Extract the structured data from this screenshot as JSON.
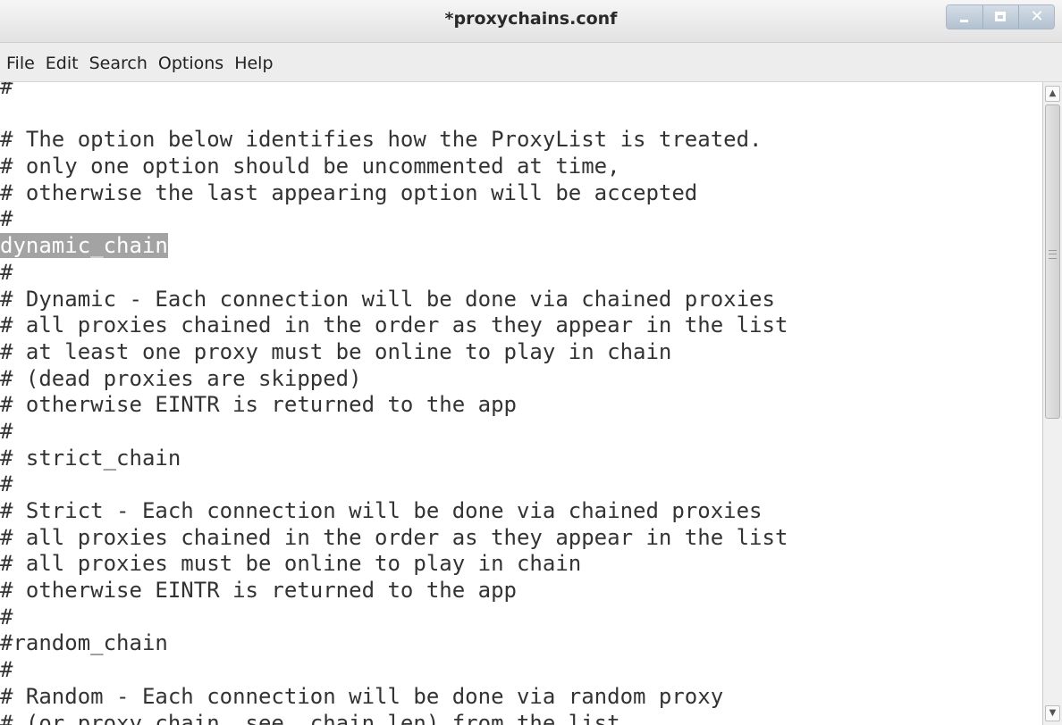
{
  "window": {
    "title": "*proxychains.conf"
  },
  "menu": {
    "items": [
      "File",
      "Edit",
      "Search",
      "Options",
      "Help"
    ]
  },
  "editor": {
    "lines": [
      "#",
      "",
      "# The option below identifies how the ProxyList is treated.",
      "# only one option should be uncommented at time,",
      "# otherwise the last appearing option will be accepted",
      "#",
      "dynamic_chain",
      "#",
      "# Dynamic - Each connection will be done via chained proxies",
      "# all proxies chained in the order as they appear in the list",
      "# at least one proxy must be online to play in chain",
      "# (dead proxies are skipped)",
      "# otherwise EINTR is returned to the app",
      "#",
      "# strict_chain",
      "#",
      "# Strict - Each connection will be done via chained proxies",
      "# all proxies chained in the order as they appear in the list",
      "# all proxies must be online to play in chain",
      "# otherwise EINTR is returned to the app",
      "#",
      "#random_chain",
      "#",
      "# Random - Each connection will be done via random proxy",
      "# (or proxy chain, see  chain_len) from the list."
    ],
    "selected_line": 6
  },
  "colors": {
    "selection": "#a3a3a3",
    "text": "#333333",
    "window_buttons": "#b3c1d0"
  },
  "icons": {
    "minimize": "minimize-icon",
    "maximize": "maximize-icon",
    "close": "close-icon",
    "scroll_up": "chevron-up-icon",
    "scroll_down": "chevron-down-icon"
  }
}
